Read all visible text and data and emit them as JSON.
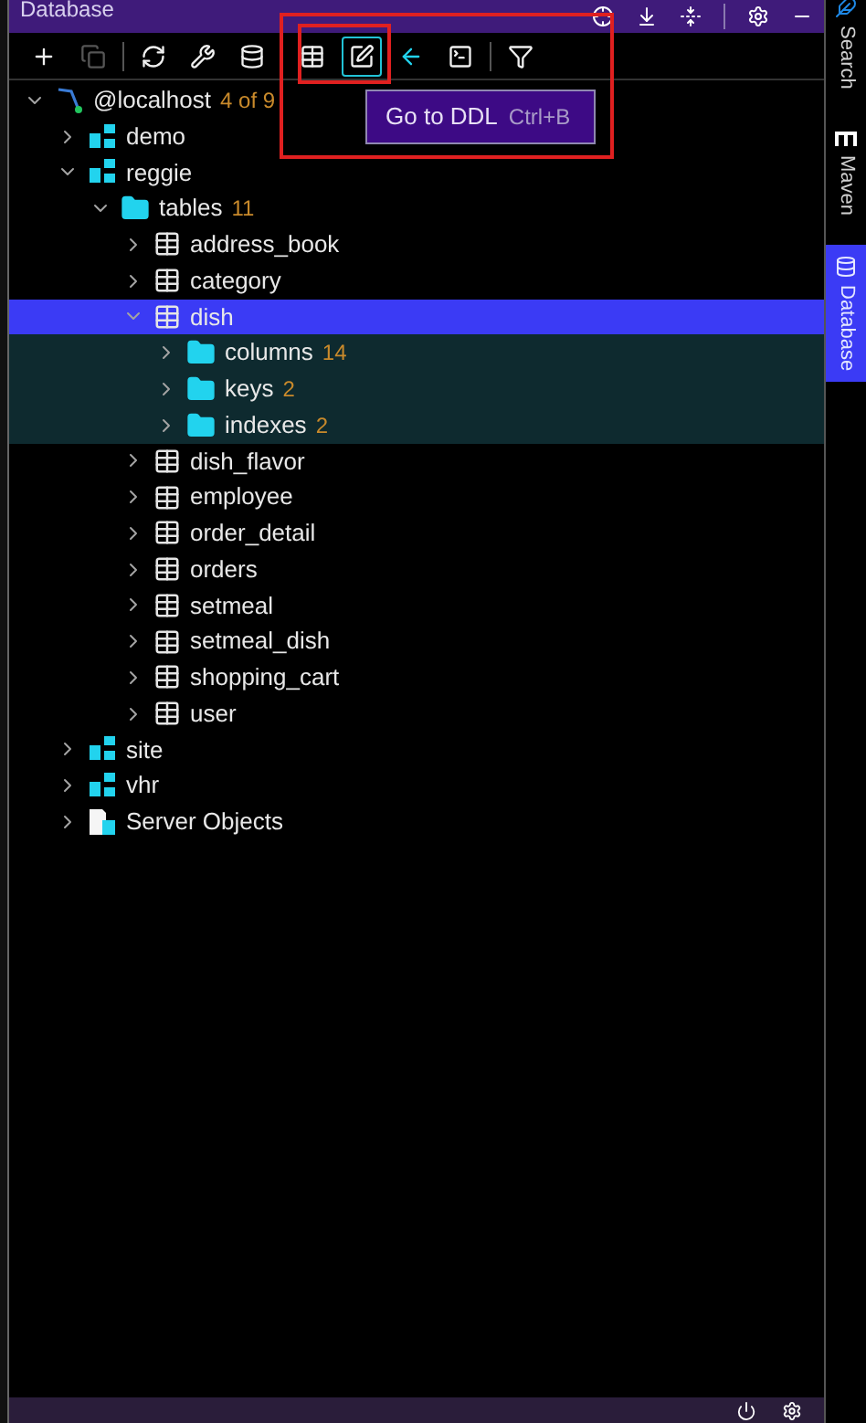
{
  "panel": {
    "title": "Database"
  },
  "toolbar": [
    {
      "kind": "add",
      "selected": false,
      "disabled": false
    },
    {
      "kind": "copy",
      "selected": false,
      "disabled": true
    },
    {
      "kind": "separator"
    },
    {
      "kind": "refresh",
      "selected": false,
      "disabled": false
    },
    {
      "kind": "properties",
      "selected": false,
      "disabled": false
    },
    {
      "kind": "database",
      "selected": false,
      "disabled": false
    },
    {
      "kind": "separator"
    },
    {
      "kind": "table",
      "selected": false,
      "disabled": false
    },
    {
      "kind": "edit",
      "selected": true,
      "disabled": false
    },
    {
      "kind": "jump",
      "selected": false,
      "disabled": false
    },
    {
      "kind": "console",
      "selected": false,
      "disabled": false
    },
    {
      "kind": "separator"
    },
    {
      "kind": "filter",
      "selected": false,
      "disabled": false
    }
  ],
  "tooltip": {
    "label": "Go to DDL",
    "shortcut": "Ctrl+B"
  },
  "tree": [
    {
      "kind": "host",
      "label": "@localhost",
      "count": "4 of 9",
      "expanded": true,
      "selected": false,
      "children": [
        {
          "kind": "schema",
          "label": "demo",
          "expanded": false,
          "selected": false
        },
        {
          "kind": "schema",
          "label": "reggie",
          "expanded": true,
          "selected": false,
          "children": [
            {
              "kind": "folder",
              "label": "tables",
              "count": "11",
              "expanded": true,
              "selected": false,
              "children": [
                {
                  "kind": "table",
                  "label": "address_book",
                  "expanded": false,
                  "selected": false
                },
                {
                  "kind": "table",
                  "label": "category",
                  "expanded": false,
                  "selected": false
                },
                {
                  "kind": "table",
                  "label": "dish",
                  "expanded": true,
                  "selected": true,
                  "children": [
                    {
                      "kind": "folder",
                      "label": "columns",
                      "count": "14",
                      "expanded": false,
                      "selected": false
                    },
                    {
                      "kind": "folder",
                      "label": "keys",
                      "count": "2",
                      "expanded": false,
                      "selected": false
                    },
                    {
                      "kind": "folder",
                      "label": "indexes",
                      "count": "2",
                      "expanded": false,
                      "selected": false
                    }
                  ]
                },
                {
                  "kind": "table",
                  "label": "dish_flavor",
                  "expanded": false,
                  "selected": false
                },
                {
                  "kind": "table",
                  "label": "employee",
                  "expanded": false,
                  "selected": false
                },
                {
                  "kind": "table",
                  "label": "order_detail",
                  "expanded": false,
                  "selected": false
                },
                {
                  "kind": "table",
                  "label": "orders",
                  "expanded": false,
                  "selected": false
                },
                {
                  "kind": "table",
                  "label": "setmeal",
                  "expanded": false,
                  "selected": false
                },
                {
                  "kind": "table",
                  "label": "setmeal_dish",
                  "expanded": false,
                  "selected": false
                },
                {
                  "kind": "table",
                  "label": "shopping_cart",
                  "expanded": false,
                  "selected": false
                },
                {
                  "kind": "table",
                  "label": "user",
                  "expanded": false,
                  "selected": false
                }
              ]
            }
          ]
        },
        {
          "kind": "schema",
          "label": "site",
          "expanded": false,
          "selected": false
        },
        {
          "kind": "schema",
          "label": "vhr",
          "expanded": false,
          "selected": false
        },
        {
          "kind": "server",
          "label": "Server Objects",
          "expanded": false,
          "selected": false
        }
      ]
    }
  ],
  "side_tabs": [
    {
      "kind": "search",
      "label": "Search",
      "selected": false
    },
    {
      "kind": "maven",
      "label": "Maven",
      "selected": false
    },
    {
      "kind": "database",
      "label": "Database",
      "selected": true
    }
  ]
}
